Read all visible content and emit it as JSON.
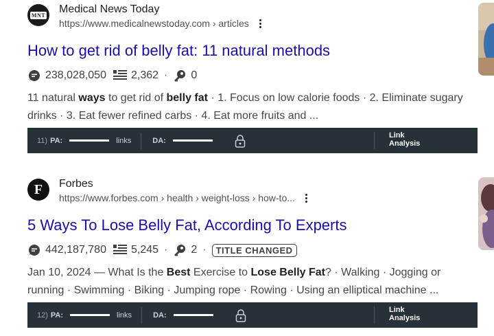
{
  "results": [
    {
      "site_name": "Medical News Today",
      "favicon_text": "MNT",
      "url": "https://www.medicalnewstoday.com › articles",
      "title": "How to get rid of belly fat: 11 natural methods",
      "visits": "238,028,050",
      "links_count": "2,362",
      "keys_count": "0",
      "badge": "",
      "snippet": [
        {
          "t": "11 natural ",
          "b": false
        },
        {
          "t": "ways",
          "b": true
        },
        {
          "t": " to get rid of ",
          "b": false
        },
        {
          "t": "belly fat",
          "b": true
        },
        {
          "t": " · 1. Focus on low calorie foods · 2. Eliminate sugary drinks · 3. Eat fewer refined carbs · 4. Eat more fruits and ...",
          "b": false
        }
      ],
      "seo": {
        "num": "11)",
        "pa": "PA:",
        "links": "links",
        "da": "DA:",
        "link_analysis_1": "Link",
        "link_analysis_2": "Analysis"
      }
    },
    {
      "site_name": "Forbes",
      "favicon_text": "F",
      "url": "https://www.forbes.com › health › weight-loss › how-to...",
      "title": "5 Ways To Lose Belly Fat, According To Experts",
      "visits": "442,187,780",
      "links_count": "5,245",
      "keys_count": "2",
      "badge": "TITLE CHANGED",
      "snippet": [
        {
          "t": "Jan 10, 2024 — What Is the ",
          "b": false
        },
        {
          "t": "Best",
          "b": true
        },
        {
          "t": " Exercise to ",
          "b": false
        },
        {
          "t": "Lose Belly Fat",
          "b": true
        },
        {
          "t": "? · Walking · Jogging or running · Swimming · Biking · Jumping rope · Rowing · Using an elliptical machine ...",
          "b": false
        }
      ],
      "seo": {
        "num": "12)",
        "pa": "PA:",
        "links": "links",
        "da": "DA:",
        "link_analysis_1": "Link",
        "link_analysis_2": "Analysis"
      }
    }
  ],
  "icons": {
    "visits": "magnifier-chat-icon",
    "links": "list-lines-icon",
    "keys": "key-icon",
    "lock": "lock-icon",
    "more": "more-vert-icon"
  },
  "colors": {
    "title_link": "#1a0dab",
    "seo_bar": "#263238"
  }
}
